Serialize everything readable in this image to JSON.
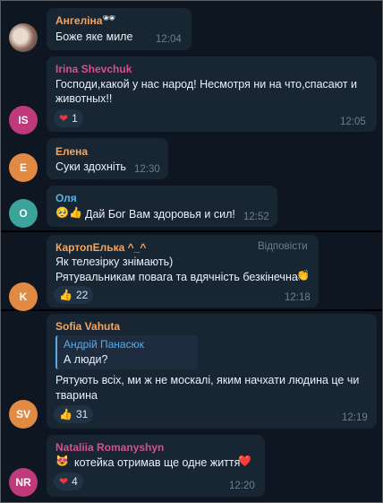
{
  "messages": [
    {
      "name": "Ангеліна",
      "name_emoji": "🕶",
      "text": "Боже яке миле",
      "time": "12:04",
      "name_color": "#f5a55f"
    },
    {
      "name": "Irina Shevchuk",
      "text1": "Господи,какой у нас народ! Несмотря ни на что,спасают и",
      "text2": "животных!!",
      "reaction": {
        "emoji": "❤",
        "count": "1"
      },
      "time": "12:05",
      "avatar": "IS",
      "avatar_color": "#c0397a",
      "name_color": "#d84f8a"
    },
    {
      "name": "Елена",
      "text": "Суки здохніть",
      "time": "12:30",
      "avatar": "E",
      "avatar_color": "#e08a43",
      "name_color": "#f5a55f"
    },
    {
      "name": "Оля",
      "text_emoji": "🥺👍",
      "text": "Дай Бог Вам здоровья и сил!",
      "time": "12:52",
      "avatar": "O",
      "avatar_color": "#3aa39a",
      "name_color": "#54b6e8"
    },
    {
      "name": "КартопЕлька ^_^",
      "reply_label": "Відповісти",
      "text1": "Як телезірку знімають)",
      "text2": "Рятувальникам повага та вдячність безкінечна",
      "text2_emoji": "👏",
      "reaction": {
        "emoji": "👍",
        "count": "22"
      },
      "time": "12:18",
      "avatar": "K",
      "avatar_color": "#e08a43",
      "name_color": "#f5a55f"
    },
    {
      "name": "Sofia Vahuta",
      "quote_name": "Андрій Панасюк",
      "quote_text": "А люди?",
      "text1": "Рятують всіх, ми ж не москалі, яким начхати людина це чи",
      "text2": "тварина",
      "reaction": {
        "emoji": "👍",
        "count": "31"
      },
      "time": "12:19",
      "avatar": "SV",
      "avatar_color": "#e08a43",
      "name_color": "#f5a55f"
    },
    {
      "name": "Nataliia Romanyshyn",
      "text_emoji": "😻",
      "text": "котейка отримав ще одне життя",
      "text_end_emoji": "❤️",
      "reaction": {
        "emoji": "❤",
        "count": "4"
      },
      "time": "12:20",
      "avatar": "NR",
      "avatar_color": "#c0397a",
      "name_color": "#d84f8a"
    }
  ]
}
